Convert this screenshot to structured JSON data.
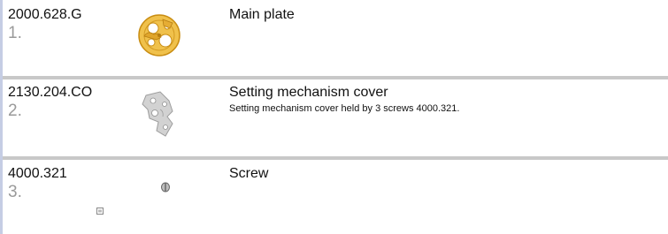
{
  "parts": [
    {
      "number": "2000.628.G",
      "index": "1.",
      "title": "Main plate",
      "description": "",
      "thumbnail_icon": "main-plate-gold-icon"
    },
    {
      "number": "2130.204.CO",
      "index": "2.",
      "title": "Setting mechanism cover",
      "description": "Setting mechanism cover held by 3 screws 4000.321.",
      "thumbnail_icon": "setting-cover-silver-icon"
    },
    {
      "number": "4000.321",
      "index": "3.",
      "title": "Screw",
      "description": "",
      "thumbnail_icon": "screw-icon"
    }
  ],
  "colors": {
    "accent_bar": "#c5cde4",
    "divider": "#c8c8c8",
    "index_text": "#9a9a9a",
    "gold": "#e8b23a",
    "silver": "#c9c9c9"
  }
}
